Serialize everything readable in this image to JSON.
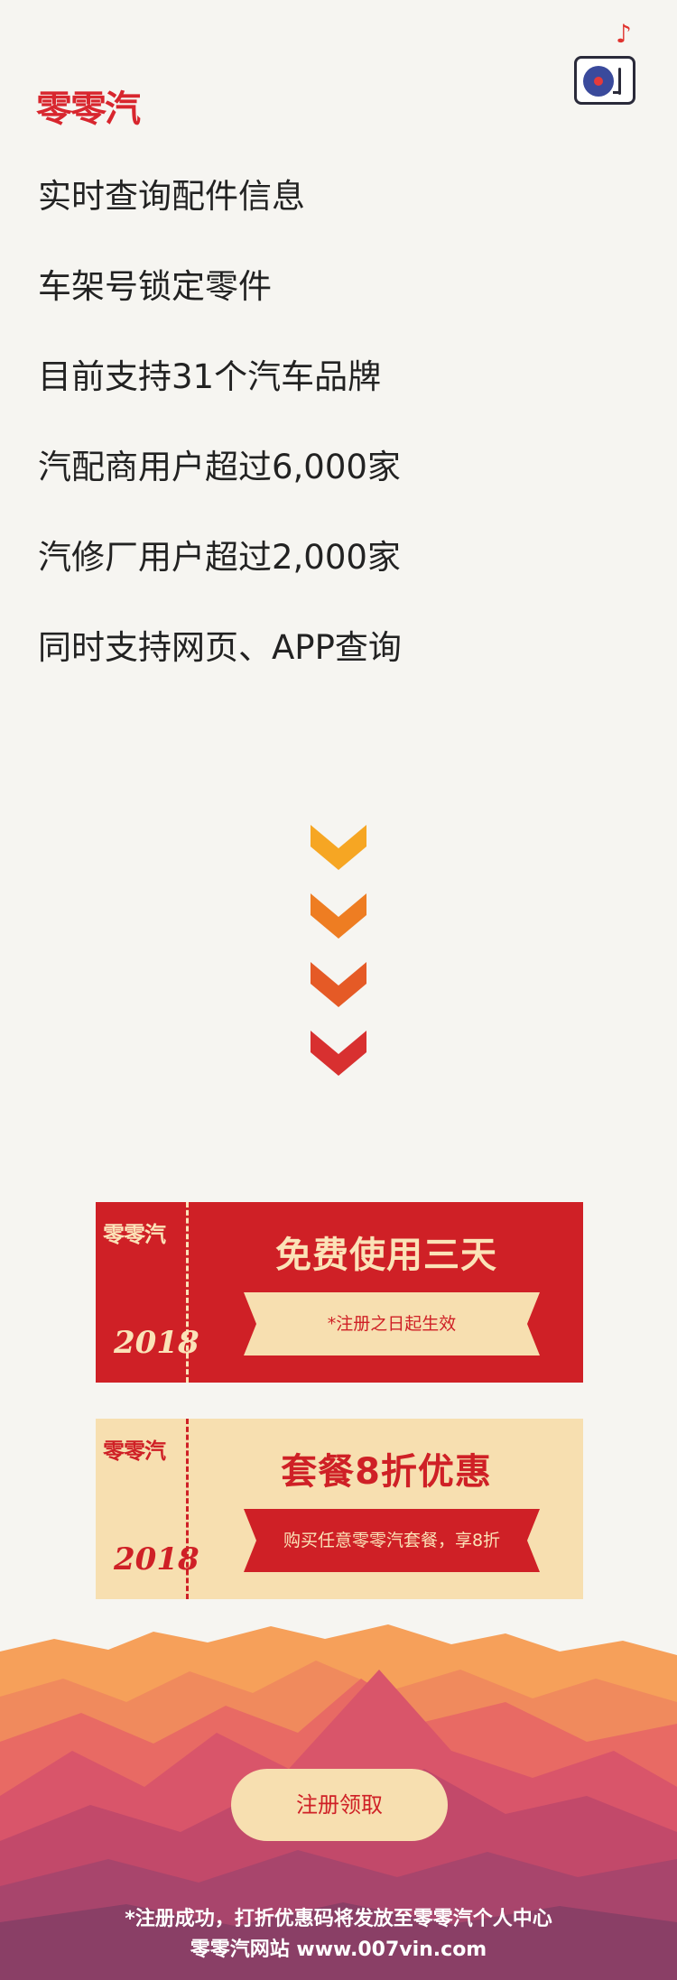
{
  "header": {
    "logo_text": "零零汽",
    "music_note": "♪",
    "music_icon": "record-player-icon"
  },
  "features": [
    "实时查询配件信息",
    "车架号锁定零件",
    "目前支持31个汽车品牌",
    "汽配商用户超过6,000家",
    "汽修厂用户超过2,000家",
    "同时支持网页、APP查询"
  ],
  "chevrons": {
    "icon": "chevron-down-icon",
    "colors": [
      "#f6a623",
      "#ee7d22",
      "#e55a26",
      "#d83030"
    ]
  },
  "coupons": [
    {
      "logo": "零零汽",
      "mark": "2018",
      "title": "免费使用三天",
      "subtitle": "*注册之日起生效",
      "background": "#cf2026",
      "ribbon_color": "#f7dfb0"
    },
    {
      "logo": "零零汽",
      "mark": "2018",
      "title": "套餐8折优惠",
      "subtitle": "购买任意零零汽套餐，享8折",
      "background": "#f7dfb0",
      "ribbon_color": "#cf2026"
    }
  ],
  "cta": {
    "label": "注册领取"
  },
  "footer": {
    "line1": "*注册成功，打折优惠码将发放至零零汽个人中心",
    "line2": "零零汽网站 www.007vin.com"
  },
  "colors": {
    "brand_red": "#cf2026",
    "cream": "#f7dfb0",
    "background": "#f6f5f1"
  }
}
